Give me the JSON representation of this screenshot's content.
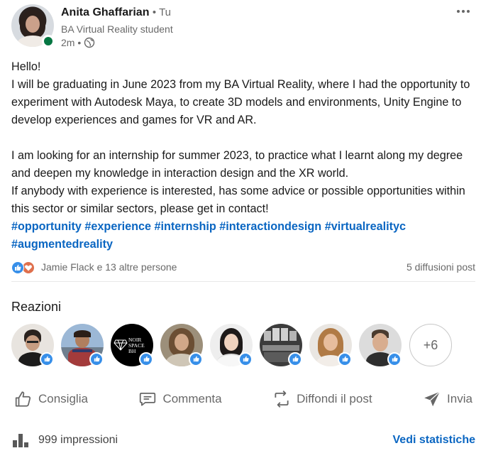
{
  "author": {
    "name": "Anita Ghaffarian",
    "degree": "• Tu",
    "headline": "BA Virtual Reality student",
    "time": "2m •",
    "status_color": "#057642"
  },
  "post": {
    "lines": [
      "Hello!",
      "I will be graduating in June 2023 from my BA Virtual Reality, where I had the opportunity to experiment with Autodesk Maya, to create 3D models and environments, Unity Engine to develop experiences and games for VR and AR.",
      "I am looking for an internship for summer 2023, to practice what I learnt along my degree and deepen my knowledge in interaction design and the XR world.",
      "If anybody with experience is interested, has some advice or possible opportunities within this sector or similar sectors, please get in contact!"
    ],
    "hashtags": [
      "#opportunity",
      "#experience",
      "#internship",
      "#interactiondesign",
      "#virtualrealityc",
      "#augmentedreality"
    ]
  },
  "social": {
    "reactors_text": "Jamie Flack e 13 altre persone",
    "shares_text": "5 diffusioni post"
  },
  "reactions": {
    "title": "Reazioni",
    "more_count": "+6",
    "noir_logo_text": "NOIR SPACE BH"
  },
  "actions": {
    "like": "Consiglia",
    "comment": "Commenta",
    "repost": "Diffondi il post",
    "send": "Invia"
  },
  "footer": {
    "impressions": "999 impressioni",
    "stats": "Vedi statistiche"
  },
  "colors": {
    "link_blue": "#0a66c2",
    "like_blue": "#378fe9",
    "love_orange": "#df704d"
  }
}
